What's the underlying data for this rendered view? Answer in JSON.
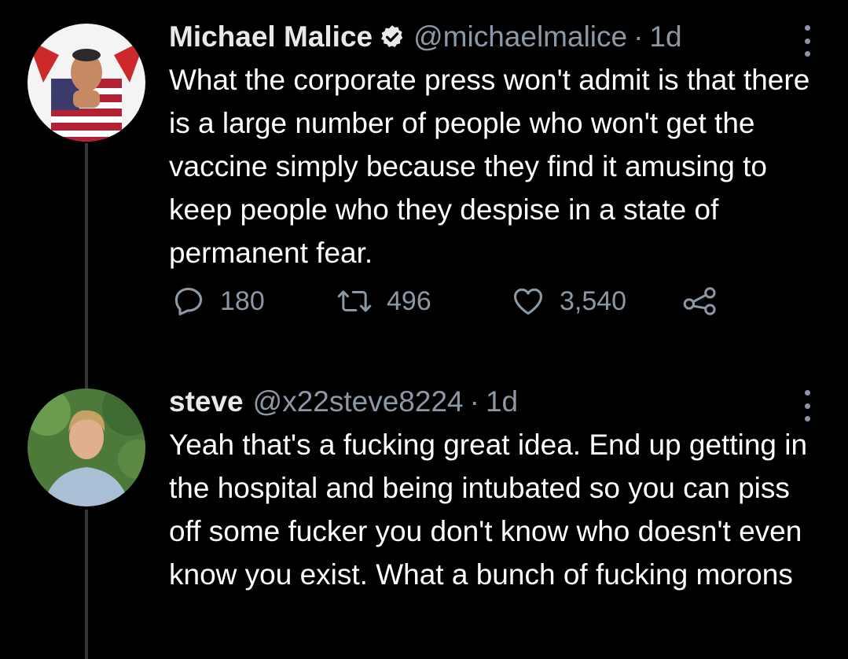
{
  "colors": {
    "background": "#000000",
    "text": "#ffffff",
    "muted": "#8b98a5",
    "thread_line": "#333639"
  },
  "tweets": [
    {
      "author_name": "Michael Malice",
      "verified": true,
      "handle": "@michaelmalice",
      "separator": "·",
      "time": "1d",
      "avatar": "avatar-flag-icon",
      "text": "What the corporate press won't admit is that there is a large number of people who won't get the vaccine simply because they find it amusing to keep people who they despise in a state of permanent fear.",
      "replies": "180",
      "retweets": "496",
      "likes": "3,540"
    },
    {
      "author_name": "steve",
      "verified": false,
      "handle": "@x22steve8224",
      "separator": "·",
      "time": "1d",
      "avatar": "avatar-photo-icon",
      "text": "Yeah that's a fucking great idea. End up getting in the hospital and being intubated so you can piss off some fucker you don't know who doesn't even know you exist. What a bunch of fucking morons"
    }
  ]
}
